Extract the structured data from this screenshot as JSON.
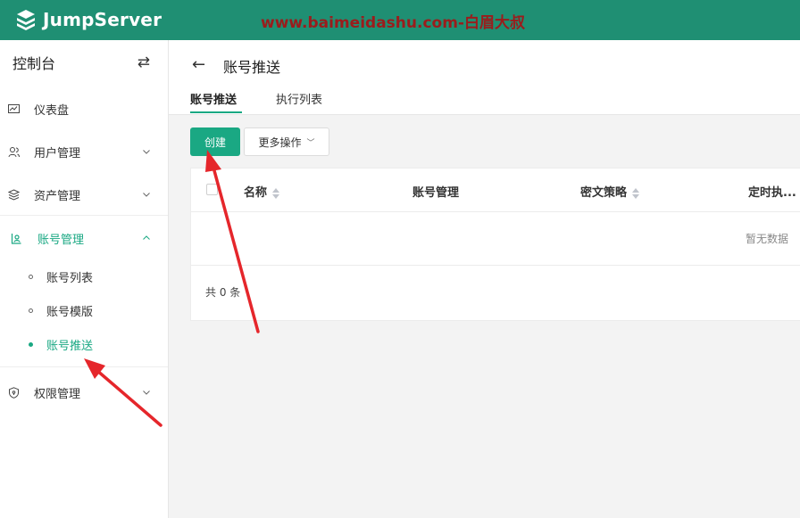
{
  "topbar": {
    "logo_text": "JumpServer",
    "watermark": "www.baimeidashu.com-白眉大叔",
    "bg_color": "#1f8f73",
    "watermark_color": "#9b1c1c"
  },
  "sidebar": {
    "title": "控制台",
    "toggle_icon": "swap-icon",
    "items": [
      {
        "label": "仪表盘",
        "icon": "dashboard-icon"
      },
      {
        "label": "用户管理",
        "icon": "users-icon"
      },
      {
        "label": "资产管理",
        "icon": "assets-icon"
      },
      {
        "label": "账号管理",
        "icon": "account-icon",
        "expanded": true
      },
      {
        "label": "权限管理",
        "icon": "permission-icon"
      }
    ],
    "subitems": [
      {
        "label": "账号列表"
      },
      {
        "label": "账号模版"
      },
      {
        "label": "账号推送",
        "active": true
      }
    ]
  },
  "header": {
    "title": "账号推送",
    "tabs": [
      {
        "label": "账号推送",
        "active": true
      },
      {
        "label": "执行列表"
      }
    ]
  },
  "toolbar": {
    "create_label": "创建",
    "more_label": "更多操作"
  },
  "table": {
    "columns": [
      "名称",
      "账号管理",
      "密文策略",
      "定时执..."
    ],
    "empty_text": "暂无数据",
    "total_text": "共 0 条"
  },
  "colors": {
    "accent": "#1aa883",
    "annotation_arrow": "#e5262b"
  }
}
